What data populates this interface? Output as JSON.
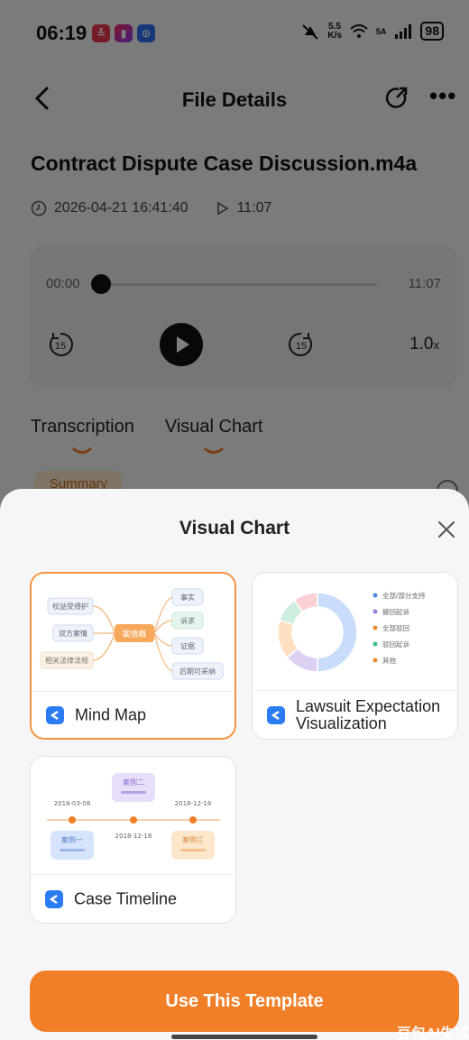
{
  "status_bar": {
    "time": "06:19",
    "net_speed_value": "5.5",
    "net_speed_unit": "K/s",
    "signal_label": "5A",
    "battery": "98"
  },
  "nav": {
    "title": "File Details"
  },
  "file": {
    "name": "Contract Dispute Case Discussion.m4a",
    "datetime": "2026-04-21 16:41:40",
    "duration": "11:07"
  },
  "player": {
    "current_time": "00:00",
    "total_time": "11:07",
    "skip_seconds": "15",
    "speed_value": "1.0",
    "speed_unit": "x",
    "progress": 0
  },
  "tabs": [
    {
      "label": "Transcription"
    },
    {
      "label": "Visual Chart"
    }
  ],
  "summary_chip": "Summary",
  "sheet": {
    "title": "Visual Chart",
    "templates": [
      {
        "label": "Mind Map",
        "selected": true
      },
      {
        "label": "Lawsuit Expectation Visualization",
        "selected": false
      },
      {
        "label": "Case Timeline",
        "selected": false
      }
    ],
    "mind_map": {
      "center": "案情概",
      "left_nodes": [
        "权益受侵护",
        "双方案情",
        "相关法律法规"
      ],
      "right_nodes": [
        "事实",
        "诉求",
        "证据",
        "后期可采纳"
      ]
    },
    "donut": {
      "legend": [
        "全部/部分支持",
        "撤回起诉",
        "全部驳回",
        "驳回起诉",
        "其他"
      ],
      "values": [
        50,
        14,
        16,
        10,
        10
      ],
      "colors": [
        "#c9dcf9",
        "#ddd0f3",
        "#fde0c2",
        "#cdeede",
        "#fbd0d4"
      ],
      "legend_dot_colors": [
        "#4d86e8",
        "#9b7fd6",
        "#f08a33",
        "#3fbf8a",
        "#f08a33"
      ]
    },
    "timeline": {
      "events": [
        {
          "label": "案例一",
          "date": "2018-03-08",
          "color": "#d6e4fb",
          "text_color": "#5b7fc8"
        },
        {
          "label": "案例二",
          "date": "2018-12-18",
          "color": "#e8defa",
          "text_color": "#8e6fcf"
        },
        {
          "label": "案例三",
          "date": "2018-12-18",
          "color": "#fde7cc",
          "text_color": "#d98b3b"
        }
      ]
    },
    "use_button": "Use This Template"
  },
  "watermark": "豆包AI生成",
  "colors": {
    "accent": "#f07f28",
    "selected_border": "#f29442",
    "template_icon": "#2b7bf2"
  }
}
